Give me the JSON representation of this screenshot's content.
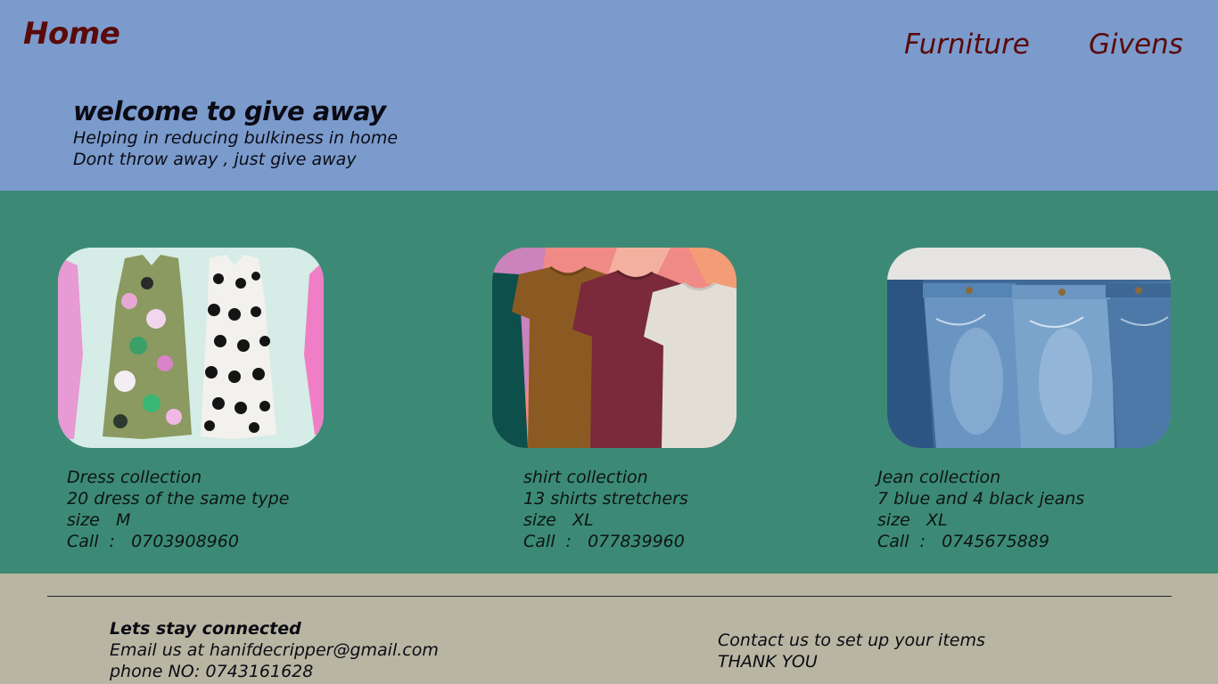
{
  "header": {
    "home_label": "Home",
    "nav": [
      {
        "label": "Furniture"
      },
      {
        "label": "Givens"
      }
    ],
    "welcome_title": "welcome to give away",
    "tagline_lines": [
      "Helping in reducing bulkiness in home",
      "Dont throw away , just give away"
    ]
  },
  "colors": {
    "header_bg": "#7b9bcd",
    "main_bg": "#3c8a76",
    "footer_bg": "#b8b6a2",
    "brand_text": "#5a0a0a"
  },
  "listings": [
    {
      "image": "dress-photo",
      "title": "Dress collection",
      "description": "20 dress of the same type",
      "size": "size   M",
      "call": "Call  :   0703908960"
    },
    {
      "image": "shirt-photo",
      "title": "shirt collection",
      "description": "13 shirts stretchers",
      "size": "size   XL",
      "call": "Call  :   077839960"
    },
    {
      "image": "jeans-photo",
      "title": "Jean collection",
      "description": "7 blue and 4 black jeans",
      "size": "size   XL",
      "call": "Call  :   0745675889"
    }
  ],
  "footer": {
    "heading": "Lets stay connected",
    "email_line": "Email us at hanifdecripper@gmail.com",
    "phone_line": "phone NO: 0743161628",
    "contact_line": "Contact us to set up your items",
    "thanks_line": "THANK YOU"
  }
}
